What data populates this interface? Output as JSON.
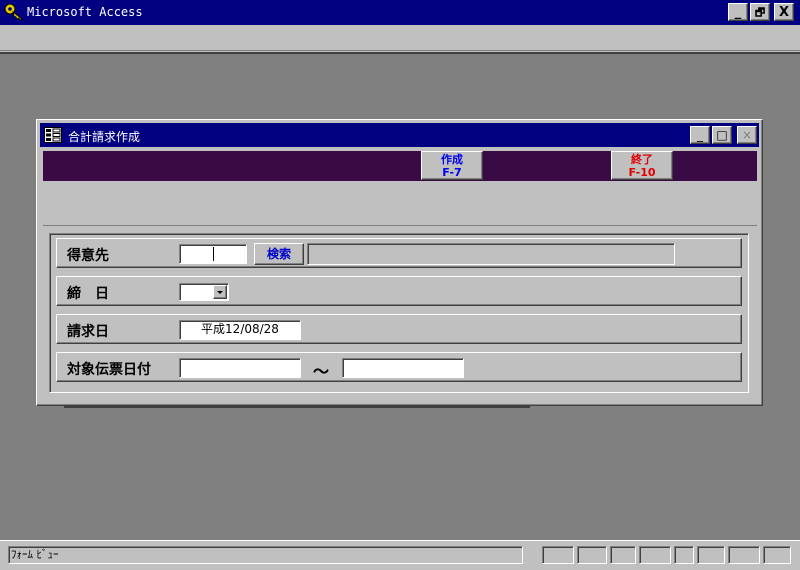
{
  "app": {
    "title": "Microsoft Access"
  },
  "title_buttons": {
    "minimize": "_",
    "restore": "🗗",
    "close": "X"
  },
  "form": {
    "title": "合計請求作成",
    "buttons": {
      "minimize": "_",
      "maximize": "□",
      "close": "×"
    },
    "commands": {
      "create": {
        "label": "作成",
        "key": "F-7",
        "color": "#0000ee"
      },
      "exit": {
        "label": "終了",
        "key": "F-10",
        "color": "#e00000"
      }
    },
    "fields": {
      "customer": {
        "label": "得意先",
        "value": "",
        "search_label": "検索",
        "name_value": ""
      },
      "closing_day": {
        "label": "締　日",
        "value": ""
      },
      "billing_date": {
        "label": "請求日",
        "value": "平成12/08/28"
      },
      "slip_date_range": {
        "label": "対象伝票日付",
        "from": "",
        "separator": "～",
        "to": ""
      }
    }
  },
  "statusbar": {
    "text": "ﾌｫｰﾑ ﾋﾞｭｰ"
  },
  "colors": {
    "titlebar": "#000080",
    "toolbar_band": "#3a0a44",
    "workspace": "#808080"
  }
}
